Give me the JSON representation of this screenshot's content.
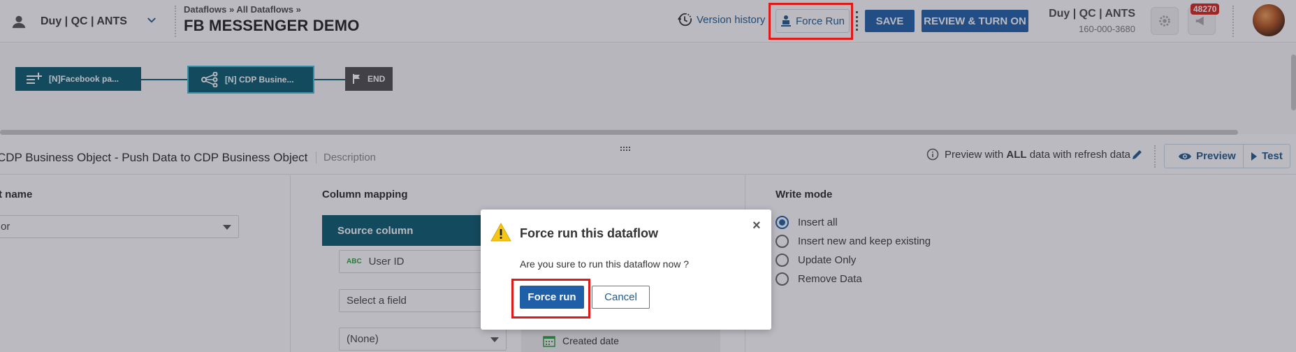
{
  "header": {
    "account_label": "Duy | QC | ANTS",
    "breadcrumb": "Dataflows » All Dataflows »",
    "title": "FB MESSENGER DEMO",
    "version_history": "Version history",
    "force_run": "Force Run",
    "save": "SAVE",
    "review_turn_on": "REVIEW & TURN ON",
    "account_name": "Duy | QC | ANTS",
    "account_id": "160-000-3680",
    "notification_count": "48270"
  },
  "canvas": {
    "source_node": "[N]Facebook pa...",
    "dest_node": "[N] CDP Busine...",
    "end_node": "END"
  },
  "panel": {
    "title": "CDP Business Object - Push Data to CDP Business Object",
    "description": "Description",
    "preview_note_prefix": "Preview with",
    "preview_note_bold": "ALL",
    "preview_note_suffix": "data with refresh data",
    "preview_btn": "Preview",
    "test_btn": "Test",
    "left_label": "t name",
    "left_value": "or",
    "column_mapping": "Column mapping",
    "source_column": "Source column",
    "field_user_id_type": "ABC",
    "field_user_id": "User ID",
    "select_field": "Select a field",
    "none_option": "(None)",
    "created_date": "Created date",
    "write_mode": "Write mode",
    "write_options": [
      "Insert all",
      "Insert new and keep existing",
      "Update Only",
      "Remove Data"
    ]
  },
  "modal": {
    "title": "Force run this dataflow",
    "close": "×",
    "message": "Are you sure to run this dataflow now ?",
    "confirm": "Force run",
    "cancel": "Cancel"
  }
}
